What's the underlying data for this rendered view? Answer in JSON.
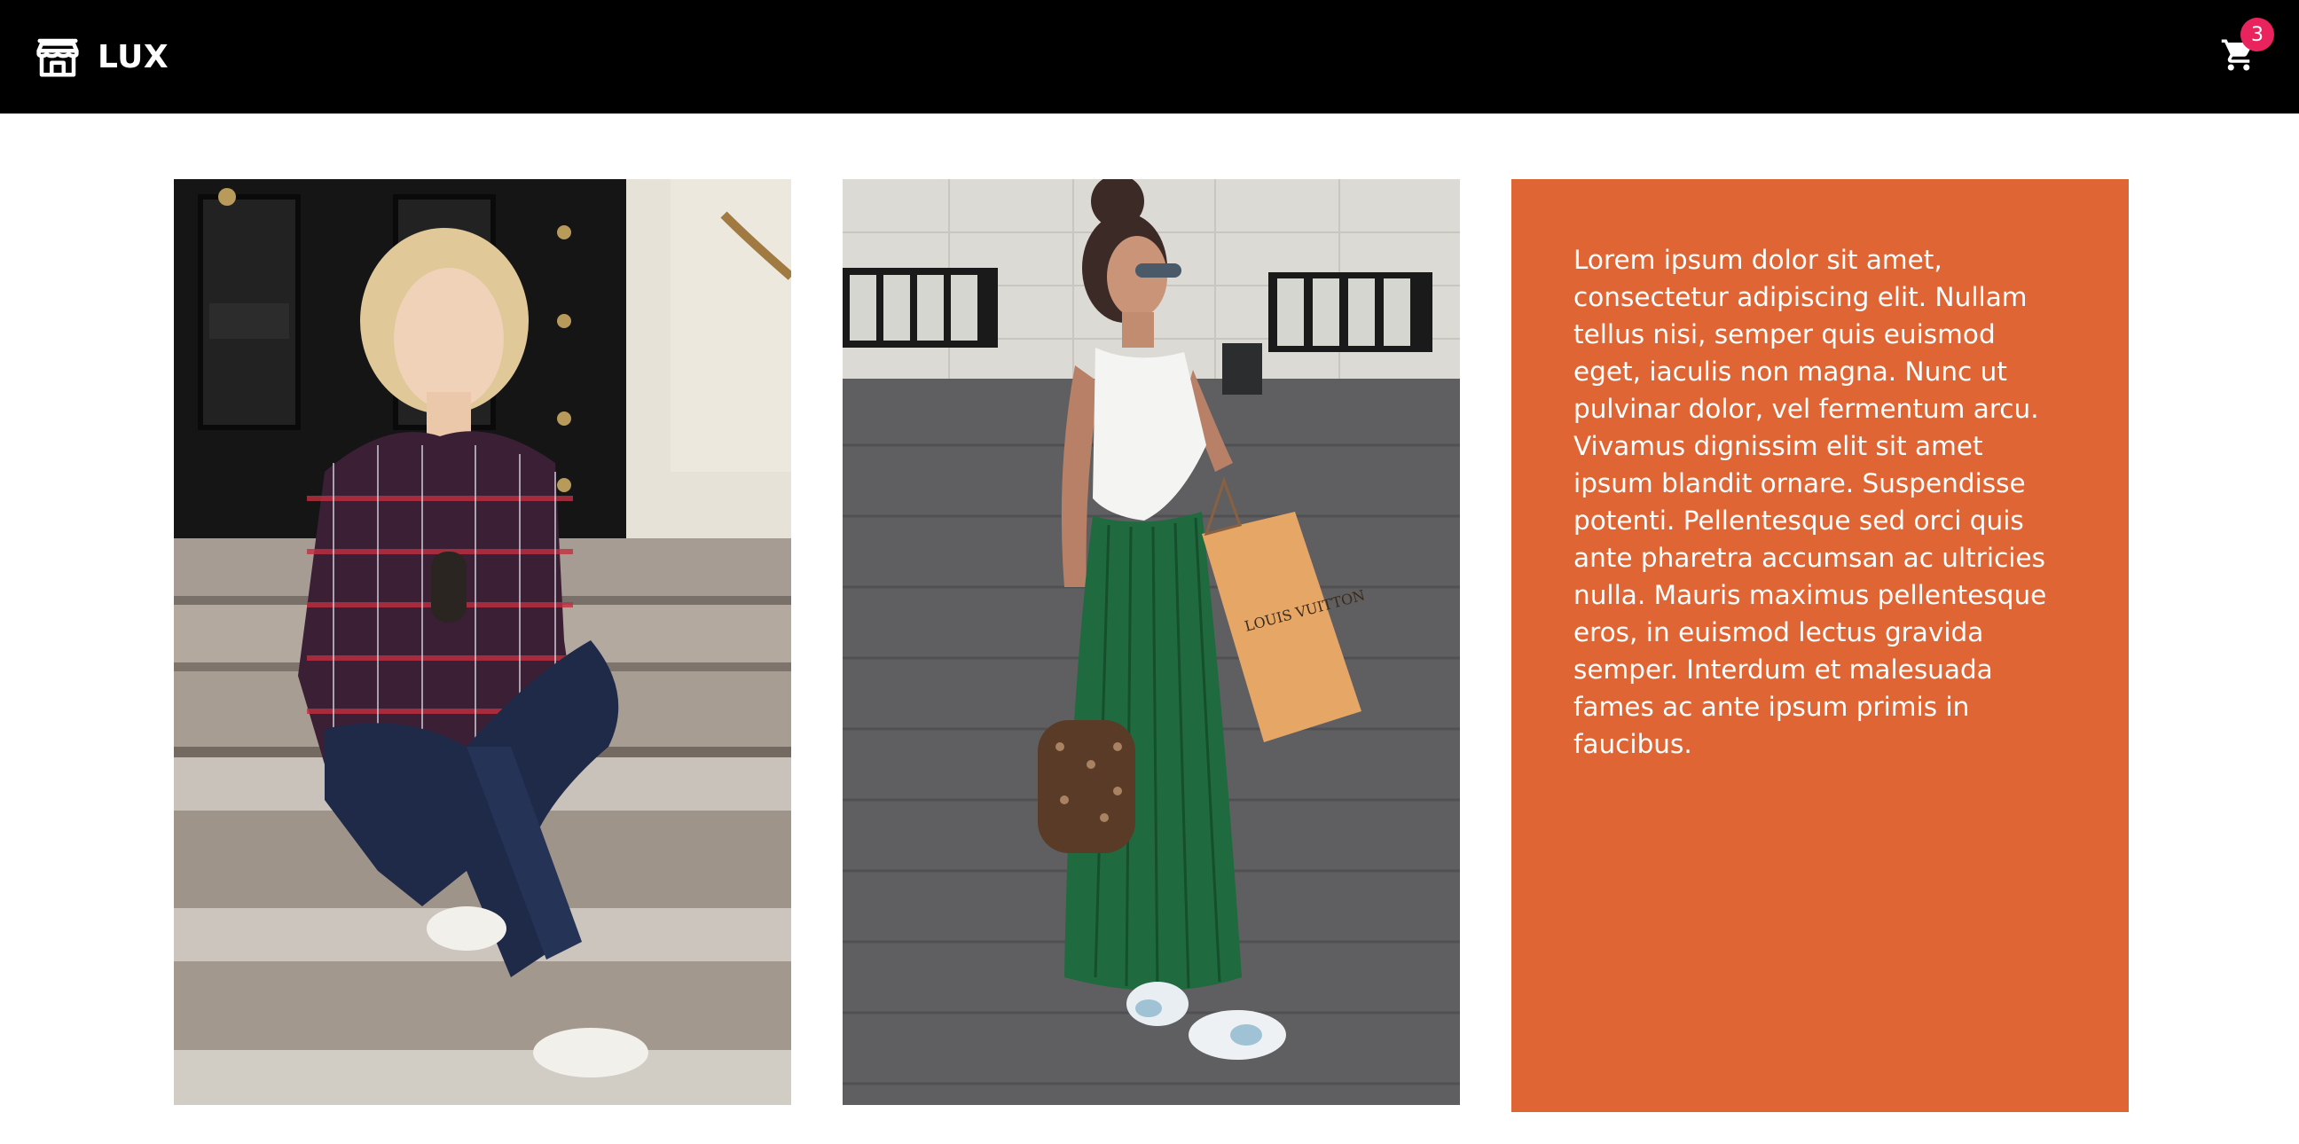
{
  "header": {
    "brand_name": "LUX",
    "logo_icon": "store-icon",
    "cart_icon": "shopping-cart-icon",
    "cart_count": "3",
    "badge_color": "#e8235e"
  },
  "gallery": {
    "images": [
      {
        "description": "woman-plaid-shirt-sitting-steps"
      },
      {
        "description": "woman-green-skirt-shopping-bag"
      }
    ]
  },
  "card": {
    "background_color": "#e06535",
    "text": "Lorem ipsum dolor sit amet, consectetur adipiscing elit. Nullam tellus nisi, semper quis euismod eget, iaculis non magna. Nunc ut pulvinar dolor, vel fermentum arcu. Vivamus dignissim elit sit amet ipsum blandit ornare. Suspendisse potenti. Pellentesque sed orci quis ante pharetra accumsan ac ultricies nulla. Mauris maximus pellentesque eros, in euismod lectus gravida semper. Interdum et malesuada fames ac ante ipsum primis in faucibus."
  }
}
